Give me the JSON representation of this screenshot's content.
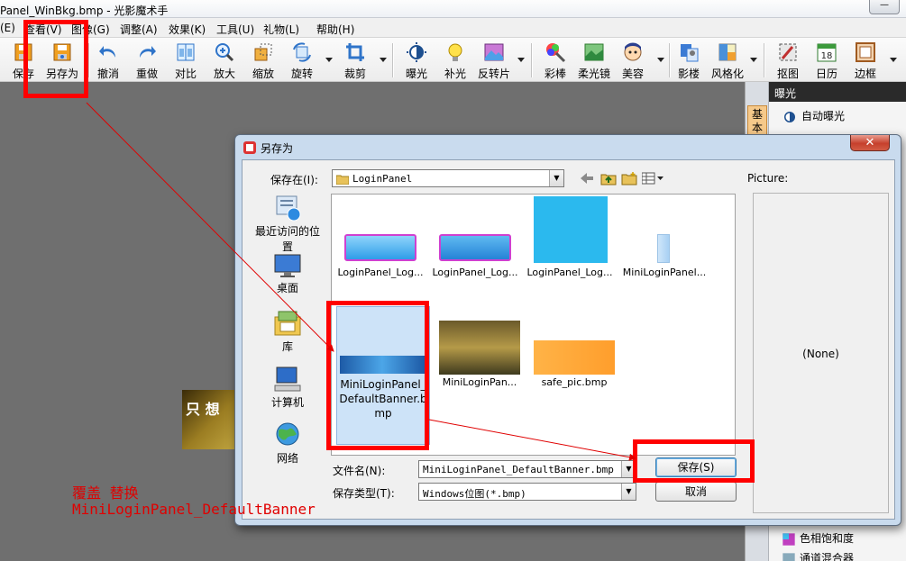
{
  "window": {
    "title": "Panel_WinBkg.bmp - 光影魔术手",
    "minimize_label": "—"
  },
  "menu": [
    {
      "label": "(E)"
    },
    {
      "label": "查看(V)"
    },
    {
      "label": "图像(G)"
    },
    {
      "label": "调整(A)"
    },
    {
      "label": "效果(K)"
    },
    {
      "label": "工具(U)"
    },
    {
      "label": "礼物(L)"
    },
    {
      "label": "帮助(H)"
    }
  ],
  "toolbar": [
    {
      "label": "保存",
      "icon": "save-icon"
    },
    {
      "label": "另存为",
      "icon": "save-as-icon"
    },
    {
      "label": "撤消",
      "icon": "undo-icon"
    },
    {
      "label": "重做",
      "icon": "redo-icon"
    },
    {
      "label": "对比",
      "icon": "compare-icon"
    },
    {
      "label": "放大",
      "icon": "zoom-in-icon"
    },
    {
      "label": "缩放",
      "icon": "resize-icon"
    },
    {
      "label": "旋转",
      "icon": "rotate-icon"
    },
    {
      "label": "裁剪",
      "icon": "crop-icon"
    },
    {
      "label": "曝光",
      "icon": "exposure-icon"
    },
    {
      "label": "补光",
      "icon": "fill-light-icon"
    },
    {
      "label": "反转片",
      "icon": "slide-film-icon"
    },
    {
      "label": "彩棒",
      "icon": "color-wand-icon"
    },
    {
      "label": "柔光镜",
      "icon": "soft-light-icon"
    },
    {
      "label": "美容",
      "icon": "beauty-icon"
    },
    {
      "label": "影楼",
      "icon": "studio-icon"
    },
    {
      "label": "风格化",
      "icon": "stylize-icon"
    },
    {
      "label": "抠图",
      "icon": "cutout-icon"
    },
    {
      "label": "日历",
      "icon": "calendar-icon"
    },
    {
      "label": "边框",
      "icon": "frame-icon"
    }
  ],
  "calendar_icon_text": "18",
  "right_panel": {
    "header": "曝光",
    "tab": "基本",
    "items": [
      {
        "label": "自动曝光",
        "icon": "auto-exposure-icon"
      },
      {
        "label": "色相饱和度",
        "icon": "hue-saturation-icon"
      },
      {
        "label": "通道混合器",
        "icon": "channel-mixer-icon"
      }
    ]
  },
  "dialog": {
    "title": "另存为",
    "close_label": "✕",
    "save_in_label": "保存在(I):",
    "save_in_value": "LoginPanel",
    "places": [
      {
        "label": "最近访问的位置",
        "icon": "recent-places-icon"
      },
      {
        "label": "桌面",
        "icon": "desktop-icon"
      },
      {
        "label": "库",
        "icon": "libraries-icon"
      },
      {
        "label": "计算机",
        "icon": "computer-icon"
      },
      {
        "label": "网络",
        "icon": "network-icon"
      }
    ],
    "files": [
      {
        "name": "LoginPanel_Log..."
      },
      {
        "name": "LoginPanel_Log..."
      },
      {
        "name": "LoginPanel_Log..."
      },
      {
        "name": "MiniLoginPanel..."
      },
      {
        "name": "MiniLoginPanel_DefaultBanner.bmp",
        "selected": true
      },
      {
        "name": "MiniLoginPan..."
      },
      {
        "name": "safe_pic.bmp"
      }
    ],
    "filename_label": "文件名(N):",
    "filename_value": "MiniLoginPanel_DefaultBanner.bmp",
    "filetype_label": "保存类型(T):",
    "filetype_value": "Windows位图(*.bmp)",
    "save_button": "保存(S)",
    "cancel_button": "取消",
    "preview_label": "Picture:",
    "preview_value": "(None)"
  },
  "annotation": {
    "line1": "覆盖 替换",
    "line2": "MiniLoginPanel_DefaultBanner",
    "color": "#e00000"
  },
  "canvas_image_text": "只 想"
}
